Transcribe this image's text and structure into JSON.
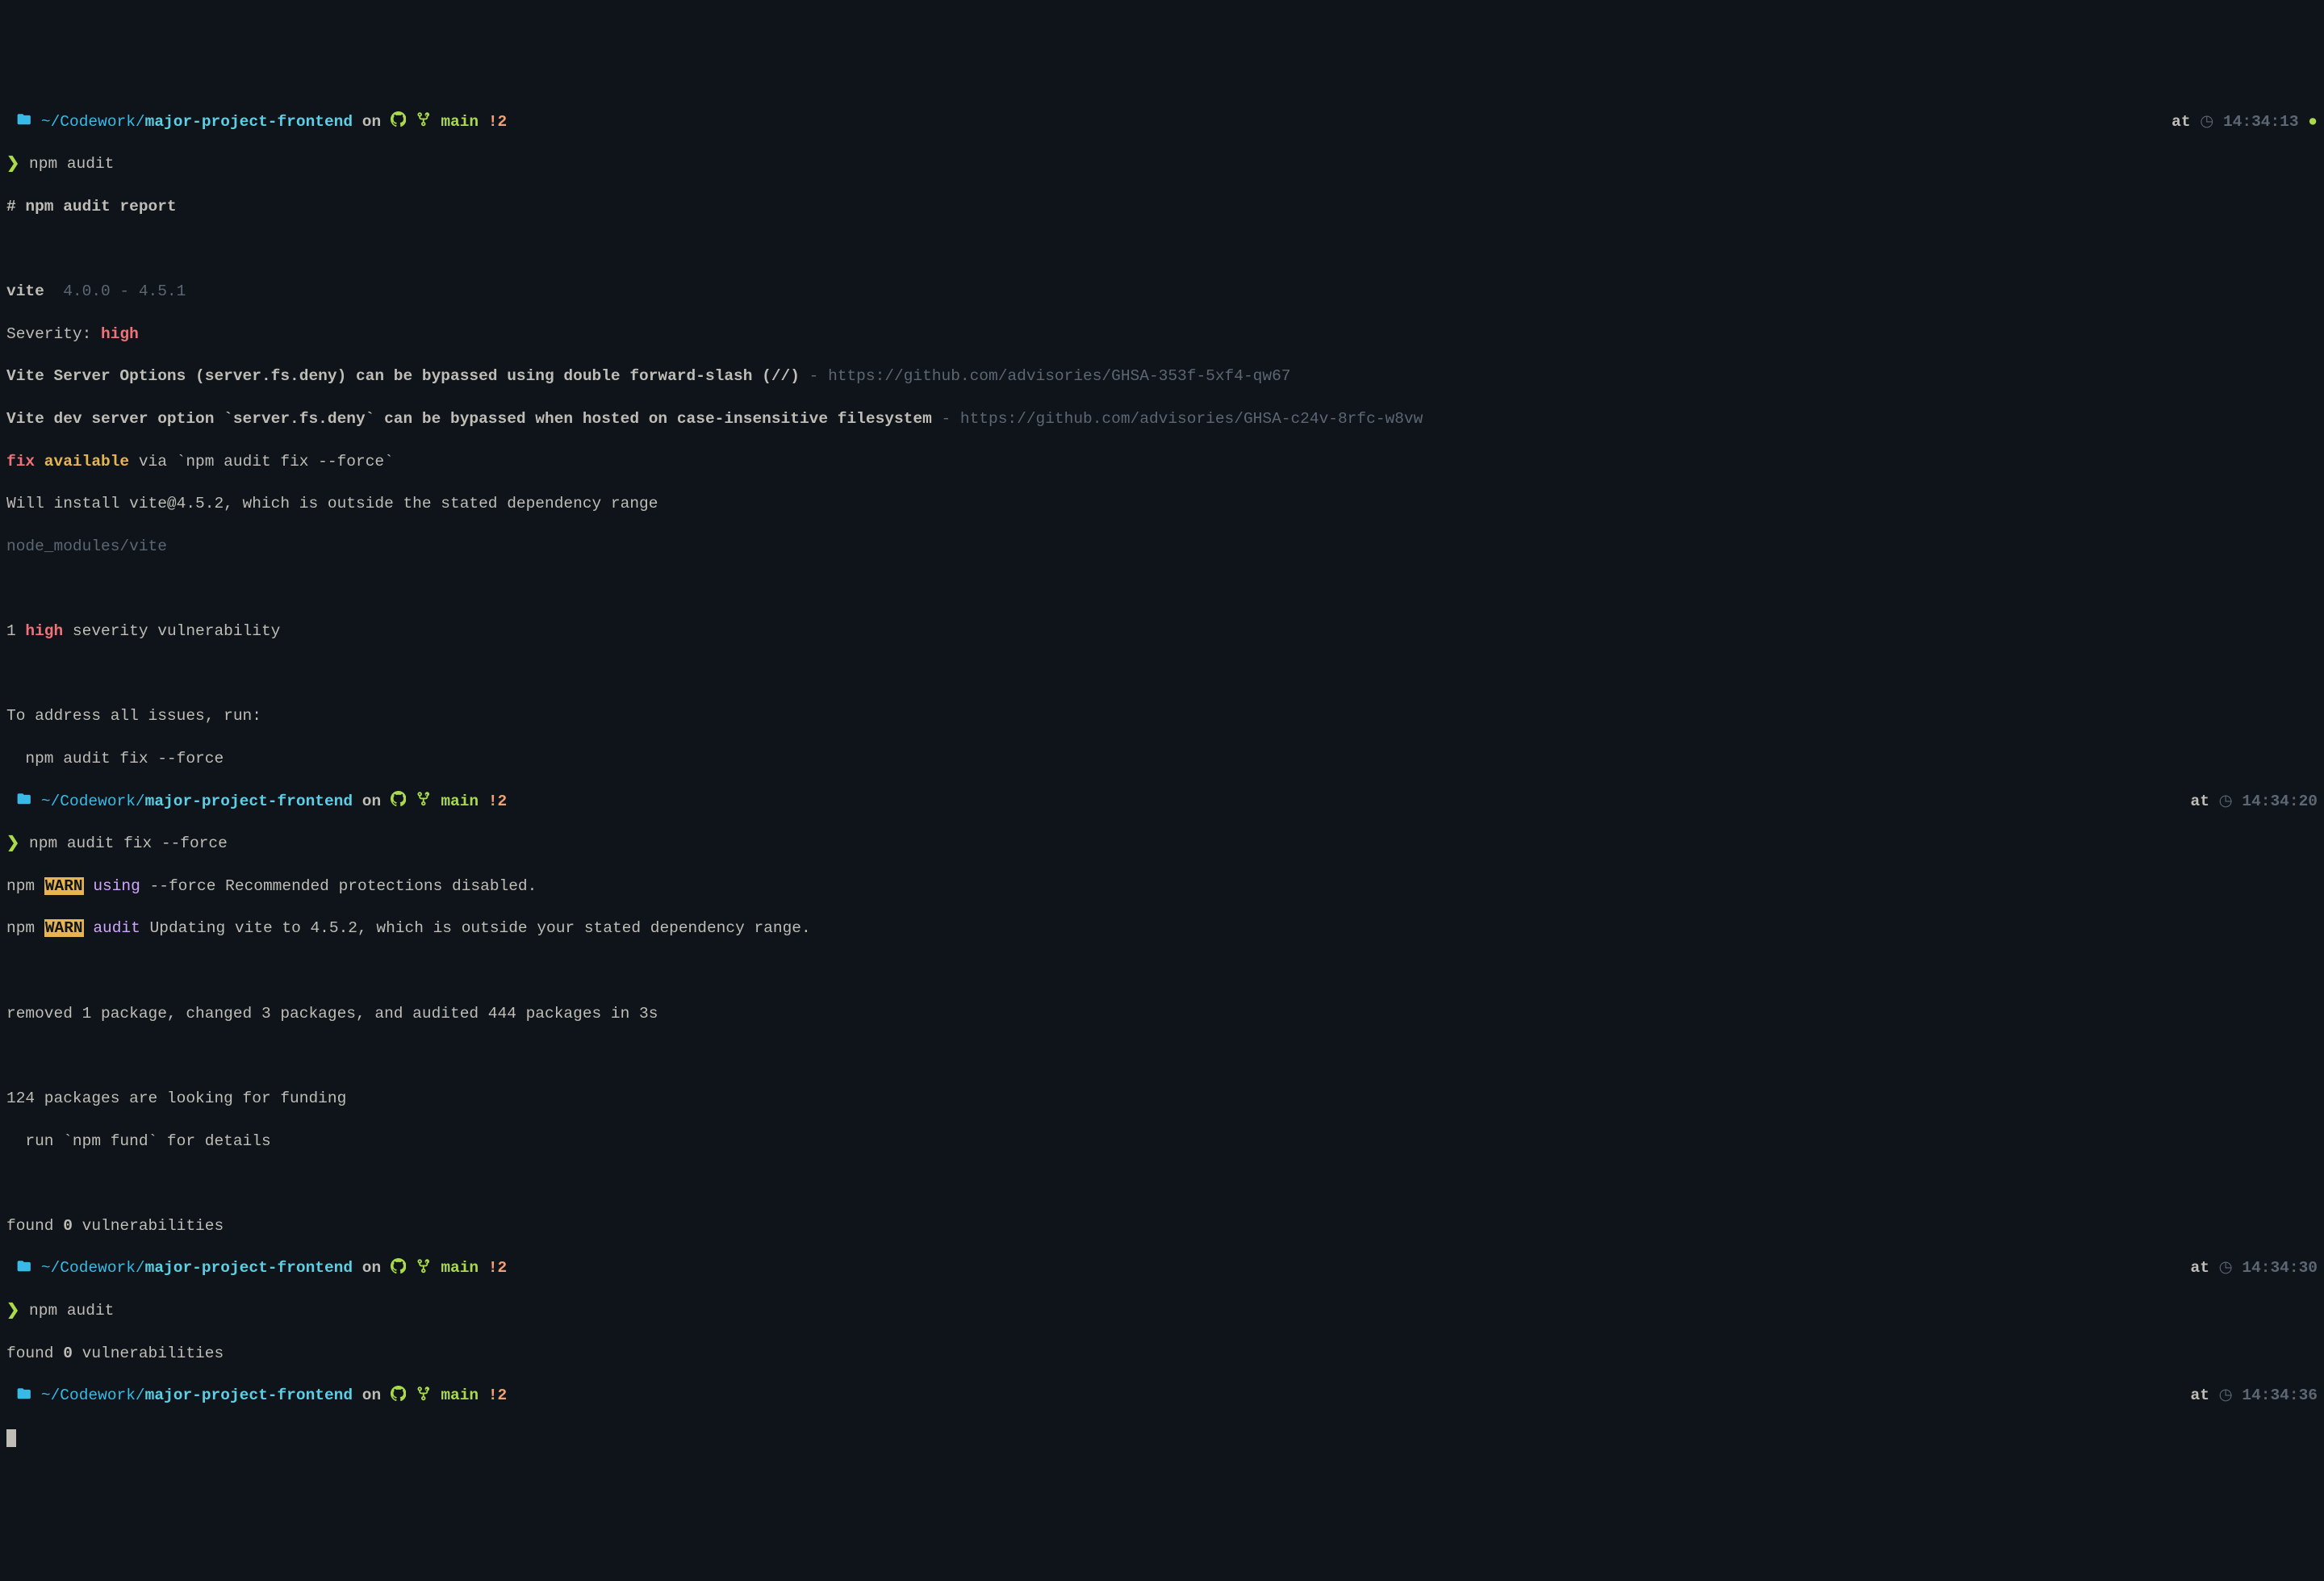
{
  "prompts": [
    {
      "path_prefix": "~/Codework/",
      "project": "major-project-frontend",
      "on": "on",
      "branch": "main",
      "changes": "!2",
      "at": "at",
      "time": "14:34:13",
      "show_status_dot": true
    },
    {
      "path_prefix": "~/Codework/",
      "project": "major-project-frontend",
      "on": "on",
      "branch": "main",
      "changes": "!2",
      "at": "at",
      "time": "14:34:20",
      "show_status_dot": false
    },
    {
      "path_prefix": "~/Codework/",
      "project": "major-project-frontend",
      "on": "on",
      "branch": "main",
      "changes": "!2",
      "at": "at",
      "time": "14:34:30",
      "show_status_dot": false
    },
    {
      "path_prefix": "~/Codework/",
      "project": "major-project-frontend",
      "on": "on",
      "branch": "main",
      "changes": "!2",
      "at": "at",
      "time": "14:34:36",
      "show_status_dot": false
    }
  ],
  "commands": {
    "c1": "npm audit",
    "c2": "npm audit fix --force",
    "c3": "npm audit"
  },
  "report": {
    "header": "# npm audit report",
    "pkg_name": "vite",
    "pkg_range": "  4.0.0 - 4.5.1",
    "severity_label": "Severity: ",
    "severity_value": "high",
    "adv1_bold": "Vite Server Options (server.fs.deny) can be bypassed using double forward-slash (//)",
    "adv1_rest": " - https://github.com/advisories/GHSA-353f-5xf4-qw67",
    "adv2_bold": "Vite dev server option `server.fs.deny` can be bypassed when hosted on case-insensitive filesystem",
    "adv2_rest": " - https://github.com/advisories/GHSA-c24v-8rfc-w8vw",
    "fix_red": "fix",
    "fix_yellow": " available",
    "fix_rest": " via `npm audit fix --force`",
    "will_install": "Will install vite@4.5.2, which is outside the stated dependency range",
    "node_modules": "node_modules/vite",
    "summary_1_num": "1 ",
    "summary_1_sev": "high",
    "summary_1_rest": " severity vulnerability",
    "address_line": "To address all issues, run:",
    "address_cmd": "  npm audit fix --force"
  },
  "fix_output": {
    "npm": "npm",
    "warn": "WARN",
    "tag1": "using",
    "line1_rest": " --force Recommended protections disabled.",
    "tag2": "audit",
    "line2_rest": " Updating vite to 4.5.2, which is outside your stated dependency range.",
    "removed": "removed 1 package, changed 3 packages, and audited 444 packages in 3s",
    "funding1": "124 packages are looking for funding",
    "funding2": "  run `npm fund` for details",
    "found_a": "found ",
    "found_b": "0",
    "found_c": " vulnerabilities"
  },
  "audit2": {
    "found_a": "found ",
    "found_b": "0",
    "found_c": " vulnerabilities"
  }
}
